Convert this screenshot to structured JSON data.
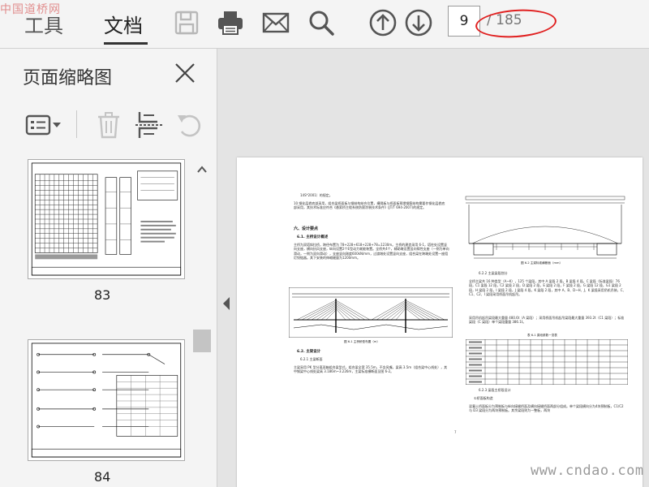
{
  "watermark_top": "中国道桥网",
  "toolbar": {
    "tab_tools": "工具",
    "tab_document": "文档",
    "current_page": "9",
    "total_pages": "/ 185"
  },
  "thumbnail_panel": {
    "title": "页面缩略图",
    "thumbnails": [
      {
        "label": "83"
      },
      {
        "label": "84"
      }
    ]
  },
  "document": {
    "para1": "14S*2001）的规定。",
    "para2": "10.钢化层檐底部采用，组合梁桥面板与钢结构结合位置，横隔板与桥面板预埋钢筋结构需要作钢化层檐底部采用，其技术标准应符合《悬索桥主缆系统防腐涂装技术条件》(JT/T 694-2007)的规定。",
    "section6": "六、设计要点",
    "sub61": "6.1. 主桥设计概述",
    "para3": "主桥为双塔斜拉桥，跨径布置为 78+228+618+228+78=1230m。主桥的建造采用 6-1，塔柱处设置竖向支座，横向抗风支座，纵向设置2个E型动力耗能装置。全桥共4个，辅助墩设置竖向铸性支座（一侧为单向滑动，一侧为双向滑动），支座竖向刚度600kN/mm，过渡墩处设置竖向支座，组合梁在跨端处设置一座阻尼铰链器。其下安装的伸缩缝量为1200mm。",
    "fig61": "图 6-1 主桥桥型布置（m）",
    "sub62": "6.2. 主梁设计",
    "sub621": "6.2.1 主梁断面",
    "para4": "主梁采用 PK 型分离双箱组合梁型式，组合梁全宽 35.5m，不含风嘴，梁高 3.5m（组合梁中心线处），其中钢梁中心线处梁高 3.186m~3.226m，主梁标准横断面见图 6-2。",
    "fig62": "图 6-2 主梁标准横断面（mm）",
    "sub622": "6.2.2 主梁梁段划分",
    "para5": "全桥主梁共 16 种类型（A~K），125 个梁段，其中 A 梁段 2 段，B 梁段 4 段，C 梁段（标准梁段）76 段，C1 梁段 12 段，C2 梁段 2 段，D 梁段 2 段，E 梁段 2 段，F 梁段 2 段，G 梁段 12 段，G1 梁段 2 段，H 梁段 2 段，I 梁段 2 段，J 梁段 4 段，K 梁段 2 段，其中 A、B、D~H、J、K 梁段采用吊机吊装，C、C1、C2、I 梁段采用桥面吊机起吊。",
    "para6": "采用吊机起吊梁段最大重量 480.6t（A 梁段）；采用桥面吊机起吊梁段最大重量 393.2t（C1 梁段）；标准梁段（C 梁段）单个梁段重量 386.1t。",
    "table_title": "表 6-1 梁段参数一览表",
    "sub623": "6.2.3 梁段主桥段设计",
    "sub_detail": "①桥面板构造",
    "para7": "混凝土桥面板分为预制板与纵向接缝桥面及横向接缝桥面两部分组成。单个梁段横向分为4块预制板，C1/C2 与 D3 梁段分为两块预制板。其余梁段则为一整板，两块",
    "page_number": "7"
  },
  "watermark_bottom": "www.cndao.com"
}
